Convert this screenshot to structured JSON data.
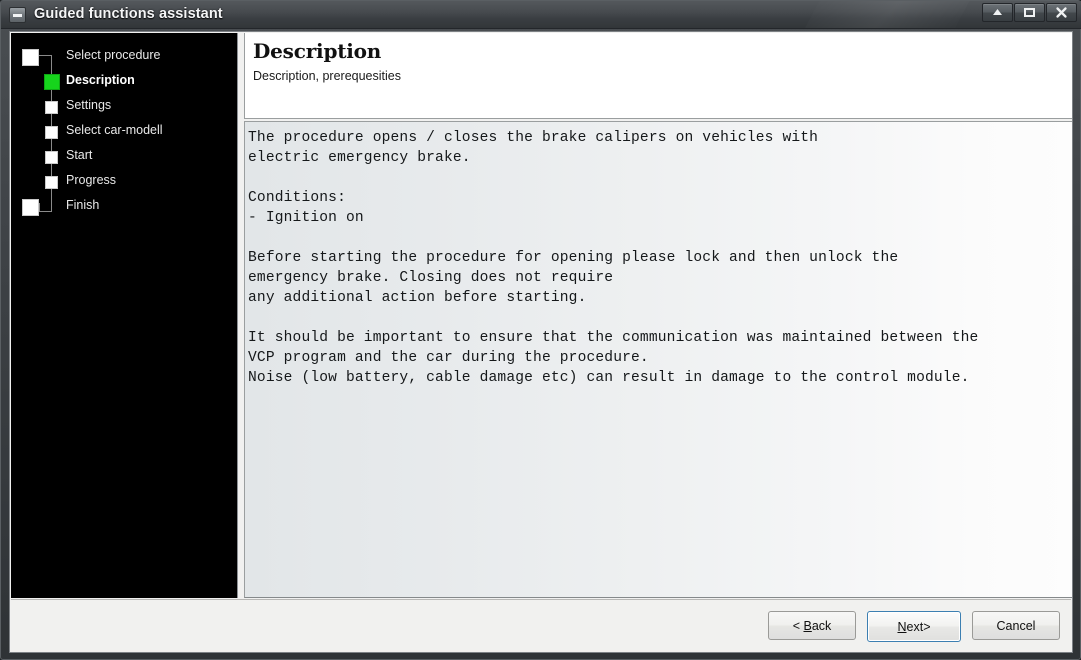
{
  "window": {
    "title": "Guided functions assistant",
    "icon": "window-minimize-box-icon",
    "controls": [
      {
        "name": "minimize-button",
        "glyph": "up-arrow-icon"
      },
      {
        "name": "restore-button",
        "glyph": "restore-box-icon"
      },
      {
        "name": "close-button",
        "glyph": "close-x-icon"
      }
    ]
  },
  "sidebar": {
    "steps": [
      {
        "label": "Select procedure",
        "level": "outer",
        "state": "pending"
      },
      {
        "label": "Description",
        "level": "inner",
        "state": "active"
      },
      {
        "label": "Settings",
        "level": "inner",
        "state": "pending"
      },
      {
        "label": "Select car-modell",
        "level": "inner",
        "state": "pending"
      },
      {
        "label": "Start",
        "level": "inner",
        "state": "pending"
      },
      {
        "label": "Progress",
        "level": "inner",
        "state": "pending"
      },
      {
        "label": "Finish",
        "level": "outer",
        "state": "pending"
      }
    ],
    "active_color": "#16d41c",
    "node_color": "#ffffff",
    "background": "#000000"
  },
  "header": {
    "title": "Description",
    "subtitle": "Description, prerequesities"
  },
  "body": {
    "text": "The procedure opens / closes the brake calipers on vehicles with\nelectric emergency brake.\n\nConditions:\n- Ignition on\n\nBefore starting the procedure for opening please lock and then unlock the\nemergency brake. Closing does not require\nany additional action before starting.\n\nIt should be important to ensure that the communication was maintained between the\nVCP program and the car during the procedure.\nNoise (low battery, cable damage etc) can result in damage to the control module."
  },
  "footer": {
    "buttons": {
      "back": {
        "prefix": "< ",
        "accel": "B",
        "rest": "ack"
      },
      "next": {
        "accel": "N",
        "rest": "ext",
        "suffix": " >"
      },
      "cancel": {
        "label": "Cancel"
      }
    },
    "default_button": "next",
    "focus_color": "#3c7fb1"
  }
}
